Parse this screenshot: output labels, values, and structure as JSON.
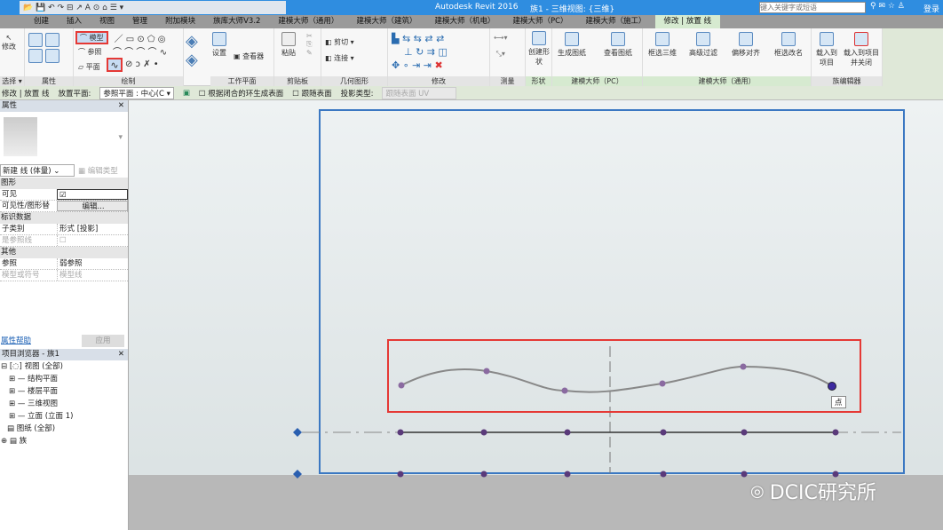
{
  "title": {
    "app": "Autodesk Revit 2016",
    "doc": "族1 - 三维视图: {三维}",
    "search_placeholder": "键入关键字或短语",
    "login": "登录"
  },
  "tabs": [
    "创建",
    "插入",
    "视图",
    "管理",
    "附加模块",
    "族库大师V3.2",
    "建模大师（通用）",
    "建模大师（建筑）",
    "建模大师（机电）",
    "建模大师（PC）",
    "建模大师（施工）",
    "修改 | 放置 线"
  ],
  "ribbon": {
    "modify": "修改",
    "select": "选择 ▾",
    "properties": "属性",
    "draw": "绘制",
    "model": "模型",
    "ref": "参照",
    "plane": "平面",
    "workplane": "工作平面",
    "set": "设置",
    "viewer": "查看器",
    "clipboard": "剪贴板",
    "paste": "粘贴",
    "geometry": "几何图形",
    "cut": "剪切",
    "join": "连接",
    "modify_panel": "修改",
    "measure": "测量",
    "form": "形状",
    "create_form": "创建形状",
    "pc": "建模大师（PC）",
    "gen_sheet": "生成图纸",
    "view_sheet": "查看图纸",
    "general": "建模大师（通用）",
    "box3d": "框选三维",
    "adv_filter": "高级过滤",
    "offset_align": "偏移对齐",
    "box_rename": "框选改名",
    "family_editor": "族编辑器",
    "load_project": "载入到项目",
    "load_close": "载入到项目并关闭"
  },
  "optbar": {
    "context": "修改 | 放置 线",
    "placement_label": "放置平面:",
    "placement_value": "参照平面 : 中心(C",
    "closed_loop": "根据闭合的环生成表面",
    "follow_surface": "跟随表面",
    "projection_label": "投影类型:",
    "projection_value": "跟随表面 UV"
  },
  "properties": {
    "title": "属性",
    "type": "新建 线 (体量)",
    "edit_type": "编辑类型",
    "groups": [
      {
        "name": "图形",
        "rows": [
          [
            "可见",
            "☑"
          ],
          [
            "可见性/图形替换",
            "编辑..."
          ]
        ]
      },
      {
        "name": "标识数据",
        "rows": [
          [
            "子类别",
            "形式 [投影]"
          ],
          [
            "是参照线",
            ""
          ]
        ]
      },
      {
        "name": "其他",
        "rows": [
          [
            "参照",
            "弱参照"
          ],
          [
            "模型或符号",
            "模型线"
          ]
        ]
      }
    ],
    "help": "属性帮助",
    "apply": "应用"
  },
  "browser": {
    "title": "项目浏览器 - 族1",
    "items": [
      "视图 (全部)",
      "结构平面",
      "楼层平面",
      "三维视图",
      "立面 (立面 1)",
      "图纸 (全部)",
      "族"
    ]
  },
  "canvas": {
    "tooltip": "点",
    "watermark": "DCIC研究所",
    "accent": "#e53935",
    "frame": "#3b78c2",
    "point_color": "#5a3a7a"
  }
}
